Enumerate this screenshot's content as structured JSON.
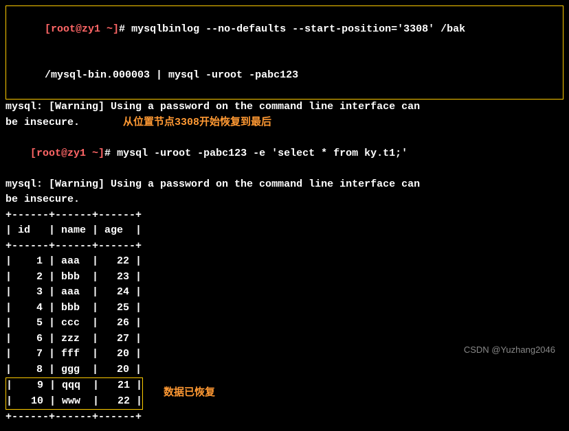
{
  "prompt": {
    "user_host": "[root@zy1 ~]",
    "hash": "#"
  },
  "cmd1": {
    "line1": "mysqlbinlog --no-defaults --start-position='3308' /bak",
    "line2": "/mysql-bin.000003 | mysql -uroot -pabc123"
  },
  "warn1": {
    "l1": "mysql: [Warning] Using a password on the command line interface can ",
    "l2": "be insecure."
  },
  "annotation1": "从位置节点3308开始恢复到最后",
  "cmd2": "mysql -uroot -pabc123 -e 'select * from ky.t1;'",
  "warn2": {
    "l1": "mysql: [Warning] Using a password on the command line interface can ",
    "l2": "be insecure."
  },
  "table": {
    "divider": "+------+------+------+",
    "header": "| id   | name | age  |",
    "rows": [
      "|    1 | aaa  |   22 |",
      "|    2 | bbb  |   23 |",
      "|    3 | aaa  |   24 |",
      "|    4 | bbb  |   25 |",
      "|    5 | ccc  |   26 |",
      "|    6 | zzz  |   27 |",
      "|    7 | fff  |   20 |",
      "|    8 | ggg  |   20 |",
      "|    9 | qqq  |   21 |",
      "|   10 | www  |   22 |"
    ]
  },
  "annotation2": "数据已恢复",
  "watermark": "CSDN @Yuzhang2046",
  "chart_data": {
    "type": "table",
    "title": "ky.t1",
    "columns": [
      "id",
      "name",
      "age"
    ],
    "rows": [
      {
        "id": 1,
        "name": "aaa",
        "age": 22
      },
      {
        "id": 2,
        "name": "bbb",
        "age": 23
      },
      {
        "id": 3,
        "name": "aaa",
        "age": 24
      },
      {
        "id": 4,
        "name": "bbb",
        "age": 25
      },
      {
        "id": 5,
        "name": "ccc",
        "age": 26
      },
      {
        "id": 6,
        "name": "zzz",
        "age": 27
      },
      {
        "id": 7,
        "name": "fff",
        "age": 20
      },
      {
        "id": 8,
        "name": "ggg",
        "age": 20
      },
      {
        "id": 9,
        "name": "qqq",
        "age": 21
      },
      {
        "id": 10,
        "name": "www",
        "age": 22
      }
    ]
  }
}
